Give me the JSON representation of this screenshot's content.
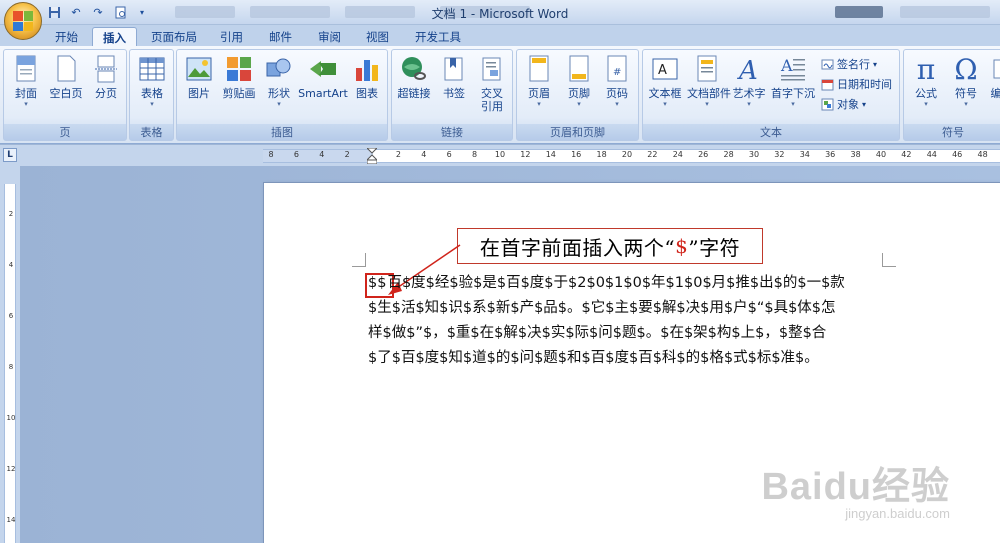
{
  "window": {
    "title": "文档 1 - Microsoft Word"
  },
  "quick_access": [
    "save",
    "undo",
    "redo",
    "print-preview"
  ],
  "tabs": [
    "开始",
    "插入",
    "页面布局",
    "引用",
    "邮件",
    "审阅",
    "视图",
    "开发工具"
  ],
  "active_tab": "插入",
  "ribbon": {
    "pages": {
      "label": "页",
      "items": [
        "封面",
        "空白页",
        "分页"
      ]
    },
    "tables": {
      "label": "表格",
      "items": [
        "表格"
      ]
    },
    "illustrations": {
      "label": "插图",
      "items": [
        "图片",
        "剪贴画",
        "形状",
        "SmartArt",
        "图表"
      ]
    },
    "links": {
      "label": "链接",
      "items": [
        "超链接",
        "书签",
        "交叉",
        "引用"
      ]
    },
    "header_footer": {
      "label": "页眉和页脚",
      "items": [
        "页眉",
        "页脚",
        "页码"
      ]
    },
    "text": {
      "label": "文本",
      "items": [
        "文本框",
        "文档部件",
        "艺术字",
        "首字下沉"
      ],
      "small": [
        "签名行",
        "日期和时间",
        "对象"
      ]
    },
    "symbols": {
      "label": "符号",
      "items": [
        "公式",
        "符号",
        "编"
      ]
    }
  },
  "ruler": {
    "corner": "L",
    "numbers": [
      "8",
      "6",
      "4",
      "2",
      "2",
      "4",
      "6",
      "8",
      "10",
      "12",
      "14",
      "16",
      "18",
      "20",
      "22",
      "24",
      "26",
      "28",
      "30",
      "32",
      "34",
      "36",
      "38",
      "40",
      "42",
      "44",
      "46",
      "48"
    ],
    "v_numbers": [
      "2",
      "4",
      "6",
      "8",
      "10",
      "12",
      "14"
    ]
  },
  "document": {
    "annotation": {
      "before": "在首字前面插入两个“",
      "dollar": "$",
      "after": "”字符"
    },
    "marked": "$$",
    "lines": [
      "百$度$经$验$是$百$度$于$2$0$1$0$年$1$0$月$推$出$的$一$款",
      "$生$活$知$识$系$新$产$品$。$它$主$要$解$决$用$户$“$具$体$怎",
      "样$做$”$，$重$在$解$决$实$际$问$题$。$在$架$构$上$，$整$合",
      "$了$百$度$知$道$的$问$题$和$百$度$百$科$的$格$式$标$准$。"
    ]
  },
  "watermark": {
    "main": "Baidu经验",
    "sub": "jingyan.baidu.com"
  }
}
